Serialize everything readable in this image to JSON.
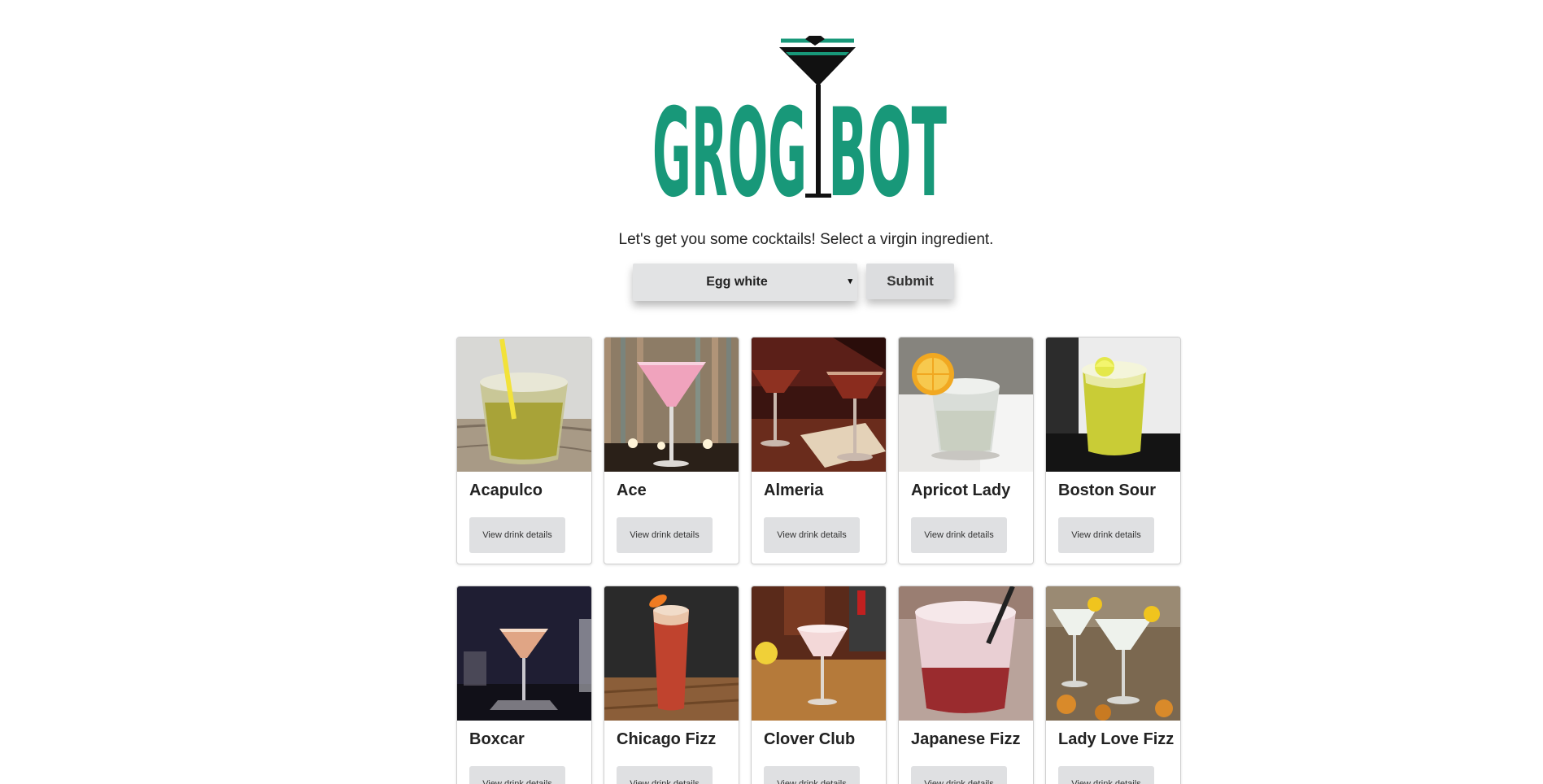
{
  "brand": {
    "logo_text_left": "GROG",
    "logo_text_right": "BOT",
    "color": "#189879"
  },
  "prompt": "Let's get you some cocktails! Select a virgin ingredient.",
  "form": {
    "selected_ingredient": "Egg white",
    "submit_label": "Submit"
  },
  "drinks": [
    {
      "name": "Acapulco",
      "button": "View drink details",
      "image": "amber drink on the rocks with yellow straw"
    },
    {
      "name": "Ace",
      "button": "View drink details",
      "image": "pink cocktail in martini glass"
    },
    {
      "name": "Almeria",
      "button": "View drink details",
      "image": "two dark red coupe cocktails"
    },
    {
      "name": "Apricot Lady",
      "button": "View drink details",
      "image": "pale drink on rocks with orange slice"
    },
    {
      "name": "Boston Sour",
      "button": "View drink details",
      "image": "yellow frothy sour with lemon"
    },
    {
      "name": "Boxcar",
      "button": "View drink details",
      "image": "peach martini on dark background"
    },
    {
      "name": "Chicago Fizz",
      "button": "View drink details",
      "image": "tall red fizz with orange peel"
    },
    {
      "name": "Clover Club",
      "button": "View drink details",
      "image": "pink foamy cocktail in coupe"
    },
    {
      "name": "Japanese Fizz",
      "button": "View drink details",
      "image": "pink frothy fizz with straw"
    },
    {
      "name": "Lady Love Fizz",
      "button": "View drink details",
      "image": "two white cocktails with lemon"
    }
  ],
  "colors": {
    "accent": "#189879",
    "button_bg": "#dfe0e2",
    "text": "#222222"
  }
}
